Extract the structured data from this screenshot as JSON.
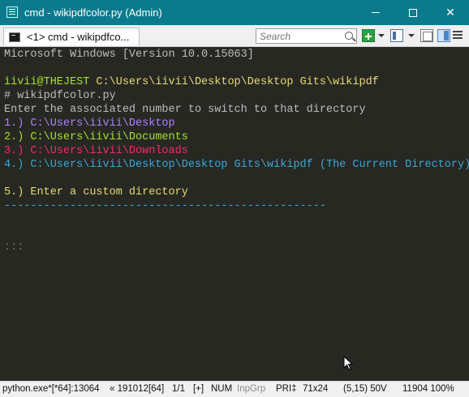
{
  "window": {
    "title": "cmd - wikipdfcolor.py (Admin)",
    "minimize_icon": "minimize-icon",
    "maximize_icon": "maximize-icon",
    "close_glyph": "✕"
  },
  "tabbar": {
    "tab_label": "<1>  cmd - wikipdfco...",
    "search_placeholder": "Search"
  },
  "console": {
    "lines": {
      "version": "Microsoft Windows [Version 10.0.15063]",
      "prompt_user": "iivii@THEJEST",
      "prompt_path": " C:\\Users\\iivii\\Desktop\\Desktop Gits\\wikipdf",
      "command": "# wikipdfcolor.py",
      "instruction": "Enter the associated number to switch to that directory",
      "option1": "1.) C:\\Users\\iivii\\Desktop",
      "option2": "2.) C:\\Users\\iivii\\Documents",
      "option3": "3.) C:\\Users\\iivii\\Downloads",
      "option4": "4.) C:\\Users\\iivii\\Desktop\\Desktop Gits\\wikipdf (The Current Directory)",
      "option5": "5.) Enter a custom directory",
      "separator": "-------------------------------------------------",
      "input_prompt": ":::"
    },
    "colors": {
      "background": "#272822",
      "default_text": "#bcbcbc",
      "green": "#a6e22e",
      "purple": "#ae81ff",
      "red": "#f92672",
      "cyan": "#3aa7d8",
      "yellow": "#e6db74"
    }
  },
  "statusbar": {
    "process": "python.exe*[*64]:13064",
    "build": "« 191012[64]",
    "pages": "1/1",
    "ins": "[+]",
    "num": "NUM",
    "inpgrp": "InpGrp",
    "pri": "PRI‡",
    "size": "71x24",
    "position": "(5,15) 50V",
    "zoom": "11904 100%"
  }
}
